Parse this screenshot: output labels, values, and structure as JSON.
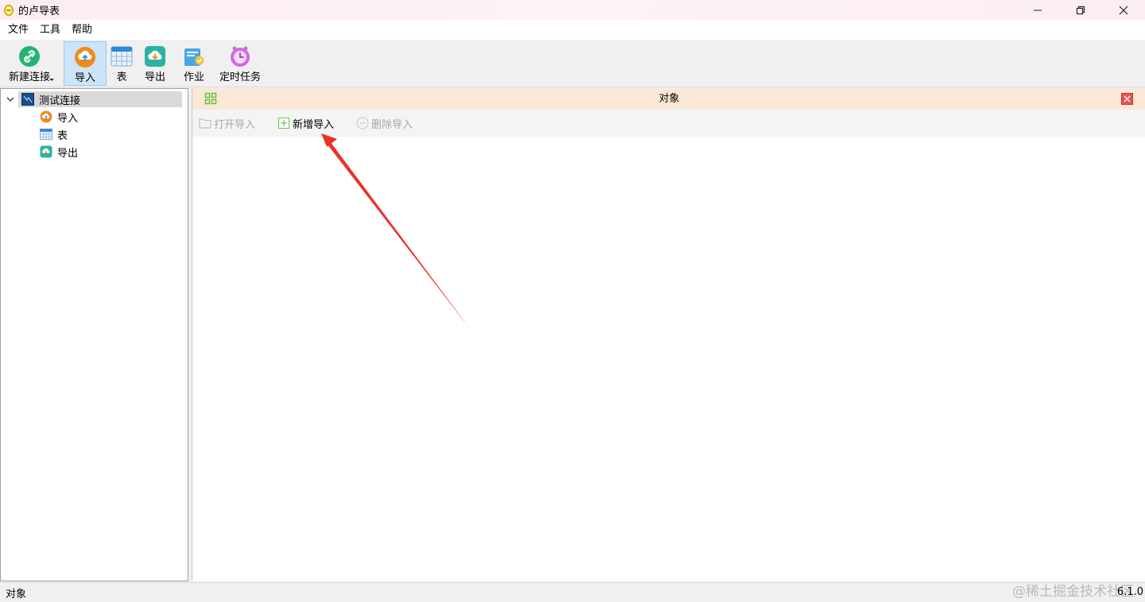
{
  "window": {
    "title": "的卢导表",
    "controls": {
      "minimize": "minimize-icon",
      "restore": "restore-icon",
      "close": "close-icon"
    }
  },
  "menu": {
    "items": [
      {
        "label": "文件"
      },
      {
        "label": "工具"
      },
      {
        "label": "帮助"
      }
    ]
  },
  "toolbar": {
    "new_connection": "新建连接",
    "import": "导入",
    "table": "表",
    "export": "导出",
    "job": "作业",
    "scheduled_task": "定时任务"
  },
  "tree": {
    "root": {
      "label": "测试连接",
      "expanded": true
    },
    "children": [
      {
        "label": "导入",
        "icon": "import-icon"
      },
      {
        "label": "表",
        "icon": "table-icon"
      },
      {
        "label": "导出",
        "icon": "export-icon"
      }
    ]
  },
  "panel": {
    "title": "对象",
    "actions": {
      "open_import": "打开导入",
      "new_import": "新增导入",
      "delete_import": "删除导入"
    }
  },
  "status": {
    "left": "对象",
    "version": "6.1.0",
    "watermark": "@稀土掘金技术社区"
  },
  "colors": {
    "titlebar": "#fbeef3",
    "panel_header": "#f9e8d6",
    "selection": "#cce4f7",
    "tree_selected": "#d9d9d9",
    "annotation_arrow": "#e8322a",
    "close_button": "#e9554d"
  }
}
